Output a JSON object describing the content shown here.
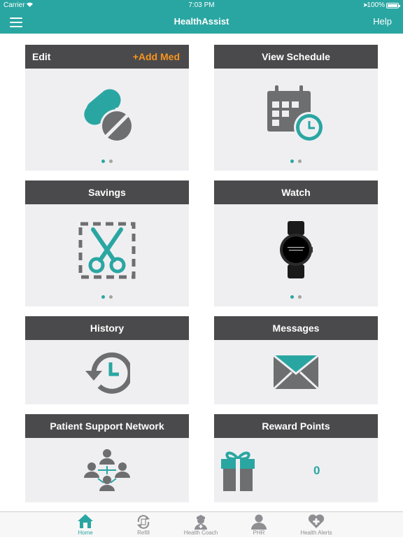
{
  "status_bar": {
    "carrier": "Carrier",
    "time": "7:03 PM",
    "battery": "100%"
  },
  "nav": {
    "title": "HealthAssist",
    "help": "Help",
    "menu_icon": "hamburger-icon"
  },
  "cards": {
    "edit": {
      "title": "Edit",
      "action": "+Add Med",
      "icon": "pills-icon"
    },
    "schedule": {
      "title": "View Schedule",
      "icon": "calendar-clock-icon"
    },
    "savings": {
      "title": "Savings",
      "icon": "scissors-coupon-icon"
    },
    "watch": {
      "title": "Watch",
      "icon": "smartwatch-icon"
    },
    "history": {
      "title": "History",
      "icon": "history-icon"
    },
    "messages": {
      "title": "Messages",
      "icon": "envelope-icon"
    },
    "network": {
      "title": "Patient Support Network",
      "icon": "people-network-icon"
    },
    "rewards": {
      "title": "Reward Points",
      "points": "0",
      "icon": "gift-icon"
    }
  },
  "tabs": [
    {
      "label": "Home",
      "icon": "home-icon",
      "active": true
    },
    {
      "label": "Refill",
      "icon": "refill-icon",
      "active": false
    },
    {
      "label": "Health Coach",
      "icon": "nurse-icon",
      "active": false
    },
    {
      "label": "PHR",
      "icon": "person-icon",
      "active": false
    },
    {
      "label": "Health Alerts",
      "icon": "heart-plus-icon",
      "active": false
    }
  ],
  "colors": {
    "accent": "#2aa6a2",
    "header": "#4a4a4c",
    "card_bg": "#efeff2",
    "orange": "#f7941d",
    "icon_gray": "#6d6e70"
  }
}
